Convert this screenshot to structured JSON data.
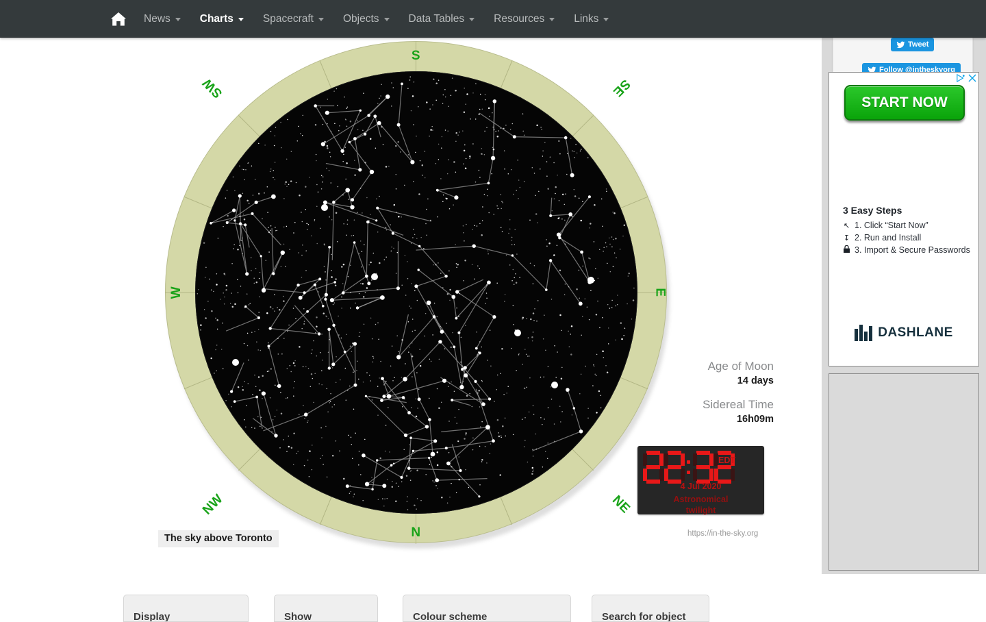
{
  "navbar": {
    "home_icon": "home-icon",
    "items": [
      {
        "label": "News",
        "caret": true,
        "active": false
      },
      {
        "label": "Charts",
        "caret": true,
        "active": true
      },
      {
        "label": "Spacecraft",
        "caret": true,
        "active": false
      },
      {
        "label": "Objects",
        "caret": true,
        "active": false
      },
      {
        "label": "Data Tables",
        "caret": true,
        "active": false
      },
      {
        "label": "Resources",
        "caret": true,
        "active": false
      },
      {
        "label": "Links",
        "caret": true,
        "active": false
      }
    ]
  },
  "chart": {
    "caption": "The sky above Toronto",
    "url": "https://in-the-sky.org",
    "compass": {
      "n": "N",
      "ne": "NE",
      "e": "E",
      "se": "SE",
      "s": "S",
      "sw": "SW",
      "w": "W",
      "nw": "NW"
    },
    "colors": {
      "sky": "#050505",
      "horizon_ring": "#d4d8a7",
      "compass_label": "#19a319",
      "constellation_line": "#9a9a9a",
      "star": "#ffffff"
    }
  },
  "info": {
    "age_of_moon_label": "Age of Moon",
    "age_of_moon_value": "14 days",
    "sidereal_time_label": "Sidereal Time",
    "sidereal_time_value": "16h09m"
  },
  "clock": {
    "time": "22:32",
    "hours": "22",
    "minutes": "32",
    "timezone": "EDT",
    "date": "4 Jul 2020",
    "status_line1": "Astronomical",
    "status_line2": "twilight",
    "colors": {
      "lit": "#e81818",
      "unlit": "#3a1414",
      "background": "#262626"
    }
  },
  "form_cards": [
    {
      "label": "Display"
    },
    {
      "label": "Show"
    },
    {
      "label": "Colour scheme"
    },
    {
      "label": "Search for object"
    }
  ],
  "sidebar": {
    "social": {
      "tweet_label": "Tweet",
      "follow_label": "Follow @intheskyorg",
      "brand_color": "#1b95e0"
    },
    "ad": {
      "choices_icon": "ad-choices-icon",
      "close_icon": "close-icon",
      "cta_label": "START NOW",
      "steps_title": "3 Easy Steps",
      "steps": [
        {
          "icon": "cursor-icon",
          "glyph": "↖",
          "text": "1. Click “Start Now”"
        },
        {
          "icon": "download-icon",
          "glyph": "↧",
          "text": "2. Run and Install"
        },
        {
          "icon": "lock-icon",
          "glyph": "🔒",
          "text": "3. Import & Secure Passwords"
        }
      ],
      "brand": "DASHLANE",
      "brand_color": "#16303d"
    }
  }
}
